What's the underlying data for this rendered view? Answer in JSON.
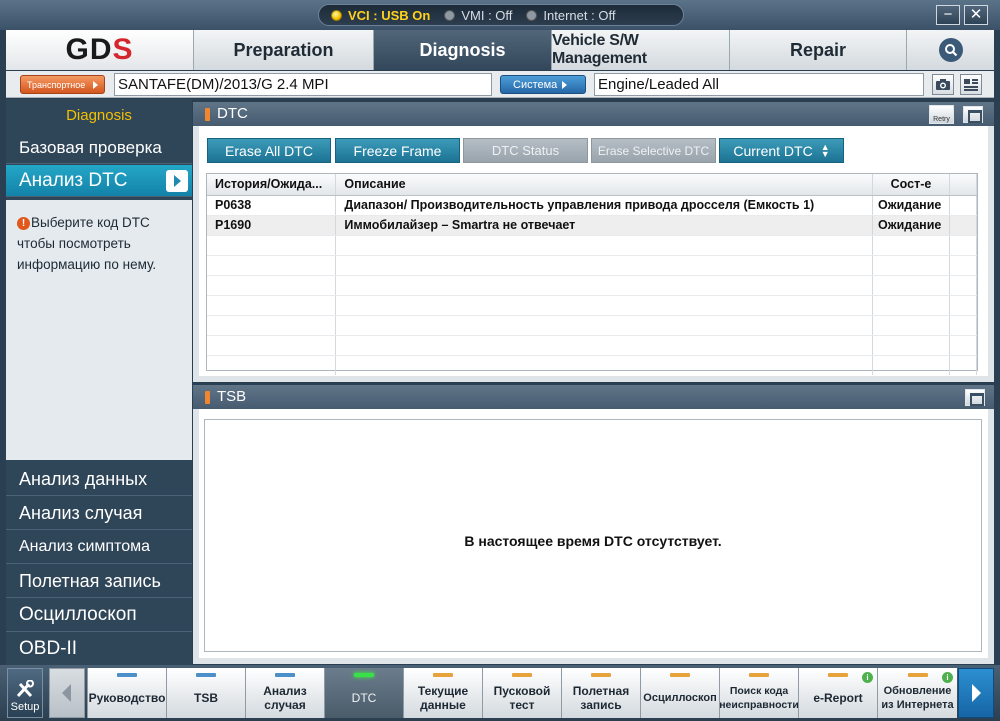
{
  "status": {
    "vci": "VCI : USB On",
    "vmi": "VMI : Off",
    "internet": "Internet : Off"
  },
  "window_controls": {
    "minimize": "−",
    "close": "✕"
  },
  "logo": {
    "text_a": "GD",
    "text_b": "S"
  },
  "tabs": [
    {
      "label": "Preparation"
    },
    {
      "label": "Diagnosis"
    },
    {
      "label": "Vehicle S/W Management"
    },
    {
      "label": "Repair"
    }
  ],
  "vehicle": {
    "select_button": "Транспортное средство",
    "value": "SANTAFE(DM)/2013/G 2.4 MPI",
    "system_button": "Система",
    "system_value": "Engine/Leaded All"
  },
  "sidebar": {
    "title": "Diagnosis",
    "items": [
      {
        "label": "Базовая проверка"
      },
      {
        "label": "Анализ DTC"
      }
    ],
    "info_text": "Выберите код DTC чтобы посмотреть информацию по нему.",
    "lower_items": [
      {
        "label": "Анализ данных"
      },
      {
        "label": "Анализ случая"
      },
      {
        "label": "Анализ симптома"
      },
      {
        "label": "Полетная запись"
      },
      {
        "label": "Осциллоскоп"
      },
      {
        "label": "OBD-II"
      }
    ]
  },
  "dtc_panel": {
    "title": "DTC",
    "retry_label": "Retry",
    "buttons": [
      {
        "label": "Erase All DTC"
      },
      {
        "label": "Freeze Frame"
      },
      {
        "label": "DTC Status"
      },
      {
        "label": "Erase Selective DTC"
      },
      {
        "label": "Current DTC"
      }
    ],
    "columns": [
      "История/Ожида...",
      "Описание",
      "Сост-е"
    ],
    "rows": [
      {
        "code": "P0638",
        "description": "Диапазон/ Производительность управления привода дросселя (Емкость 1)",
        "status": "Ожидание"
      },
      {
        "code": "P1690",
        "description": "Иммобилайзер – Smartra не отвечает",
        "status": "Ожидание"
      }
    ]
  },
  "tsb_panel": {
    "title": "TSB",
    "message": "В настоящее время DTC отсутствует."
  },
  "bottom_toolbar": {
    "setup_label": "Setup",
    "tools": [
      {
        "l1": "Руководство",
        "l2": ""
      },
      {
        "l1": "TSB",
        "l2": ""
      },
      {
        "l1": "Анализ",
        "l2": "случая"
      },
      {
        "l1": "DTC",
        "l2": ""
      },
      {
        "l1": "Текущие",
        "l2": "данные"
      },
      {
        "l1": "Пусковой",
        "l2": "тест"
      },
      {
        "l1": "Полетная",
        "l2": "запись"
      },
      {
        "l1": "Осциллоскоп",
        "l2": ""
      },
      {
        "l1": "Поиск кода",
        "l2": "неисправности"
      },
      {
        "l1": "e-Report",
        "l2": ""
      },
      {
        "l1": "Обновление",
        "l2": "из Интернета"
      }
    ],
    "info_badge": "i"
  },
  "colors": {
    "accent_teal": "#1d7394",
    "active_sidebar": "#1382a8",
    "sidebar_bg": "#2f4558",
    "diagnosis_title": "#f5c000",
    "orange_marker": "#f0862e",
    "vci_on": "#ffd21a"
  },
  "icons": {
    "search": "magnifier-icon",
    "camera": "camera-icon",
    "layout": "layout-icon",
    "setup": "tools-icon",
    "prev": "chevron-left-icon",
    "next": "chevron-right-icon"
  }
}
